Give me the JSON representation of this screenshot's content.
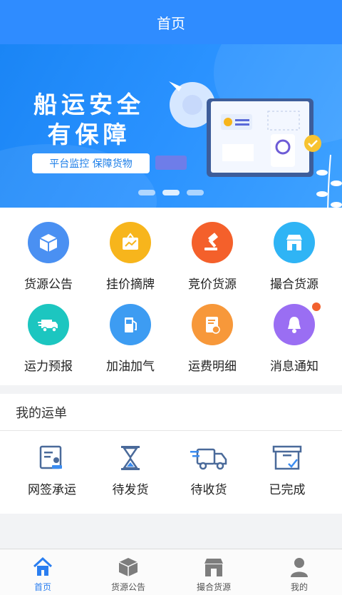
{
  "header": {
    "title": "首页"
  },
  "banner": {
    "line1": "船运安全",
    "line2": "有保障",
    "tagline": "平台监控  保障货物",
    "slide_count": 3
  },
  "grid": [
    {
      "label": "货源公告",
      "icon": "box-icon",
      "color": "#4a90f2"
    },
    {
      "label": "挂价摘牌",
      "icon": "price-board-icon",
      "color": "#f7b51c"
    },
    {
      "label": "竞价货源",
      "icon": "gavel-icon",
      "color": "#f4602b"
    },
    {
      "label": "撮合货源",
      "icon": "store-icon",
      "color": "#2fb4f5"
    },
    {
      "label": "运力预报",
      "icon": "truck-icon",
      "color": "#1cc6c0"
    },
    {
      "label": "加油加气",
      "icon": "fuel-icon",
      "color": "#3d9cf2"
    },
    {
      "label": "运费明细",
      "icon": "invoice-icon",
      "color": "#f7983a"
    },
    {
      "label": "消息通知",
      "icon": "bell-icon",
      "color": "#9a6ef3"
    }
  ],
  "orders": {
    "title": "我的运单",
    "items": [
      {
        "label": "网签承运",
        "icon": "contract-icon"
      },
      {
        "label": "待发货",
        "icon": "hourglass-icon"
      },
      {
        "label": "待收货",
        "icon": "delivery-truck-icon"
      },
      {
        "label": "已完成",
        "icon": "archive-box-icon"
      }
    ]
  },
  "tabs": [
    {
      "label": "首页",
      "icon": "home-icon",
      "active": true
    },
    {
      "label": "货源公告",
      "icon": "cube-icon",
      "active": false
    },
    {
      "label": "撮合货源",
      "icon": "shop-icon",
      "active": false
    },
    {
      "label": "我的",
      "icon": "user-icon",
      "active": false
    }
  ],
  "colors": {
    "primary": "#2f8cff",
    "tab_active": "#2a7ef0",
    "order_icon": "#4a6a9a",
    "notify_dot": "#f2612e"
  }
}
